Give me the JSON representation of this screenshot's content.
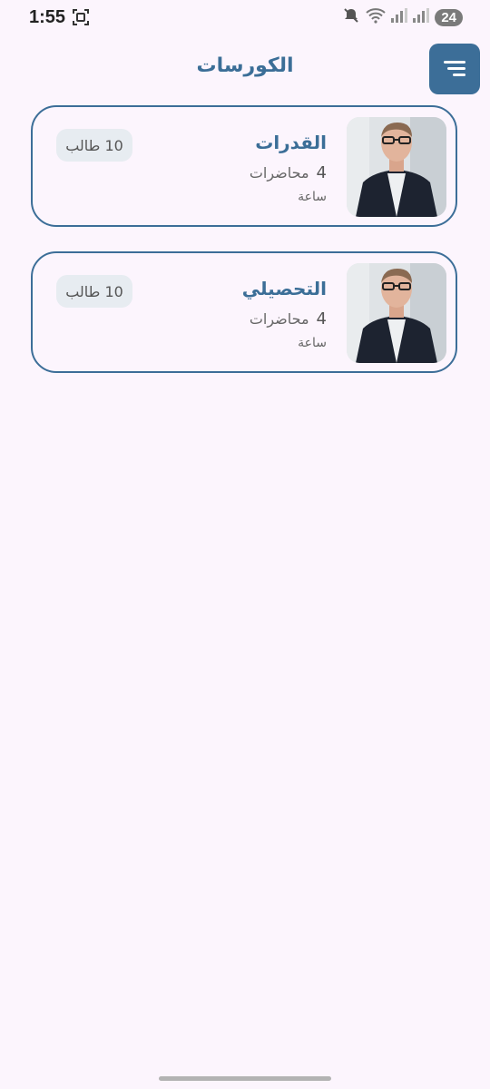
{
  "status_bar": {
    "time": "1:55",
    "battery": "24"
  },
  "header": {
    "title": "الكورسات",
    "menu_icon": "menu-icon"
  },
  "courses": [
    {
      "title": "القدرات",
      "lectures_count": "4",
      "lectures_label": "محاضرات",
      "duration": "ساعة",
      "students": "10 طالب"
    },
    {
      "title": "التحصيلي",
      "lectures_count": "4",
      "lectures_label": "محاضرات",
      "duration": "ساعة",
      "students": "10 طالب"
    }
  ],
  "colors": {
    "accent": "#3c6e98",
    "background": "#fcf5fd",
    "badge": "#e7ecf1"
  }
}
